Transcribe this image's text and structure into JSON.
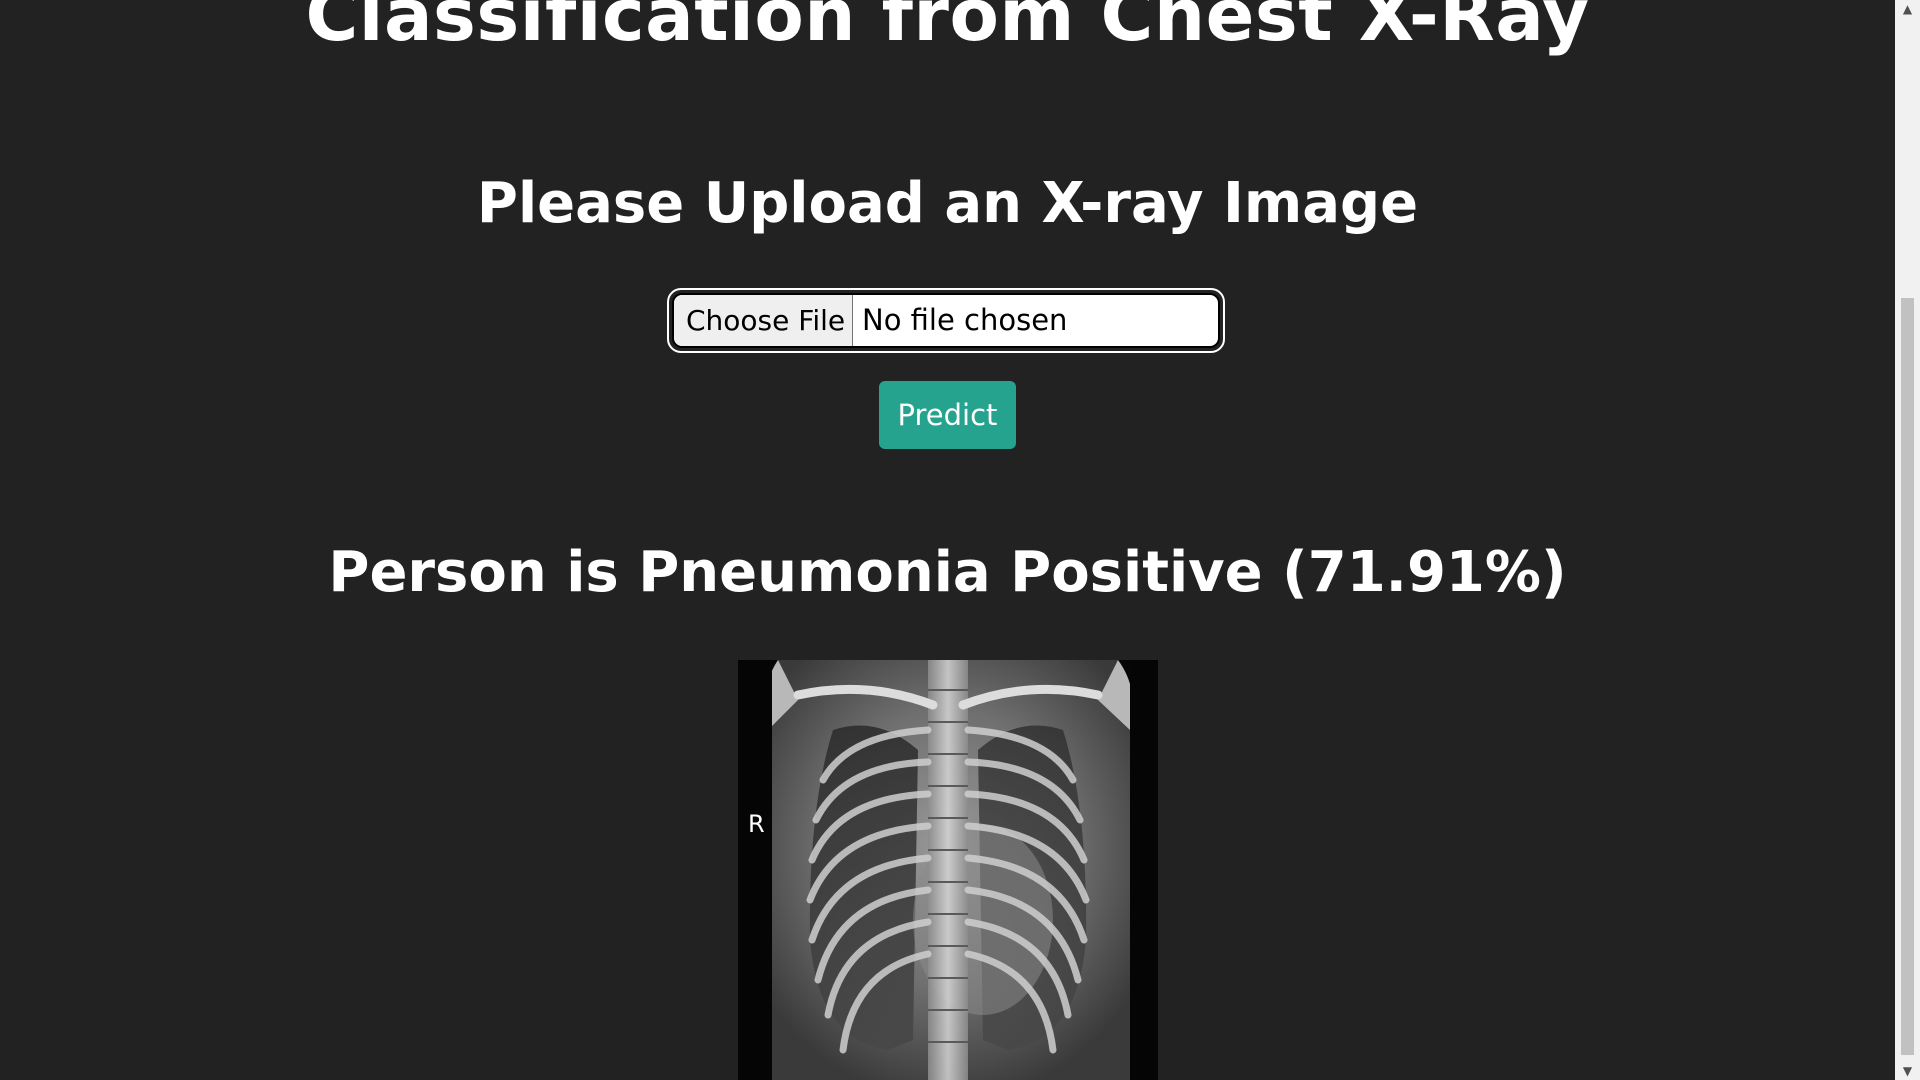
{
  "page": {
    "title": "Classification from Chest X-Ray",
    "upload_heading": "Please Upload an X-ray Image"
  },
  "file_input": {
    "button_label": "Choose File",
    "status_text": "No file chosen"
  },
  "predict_button": {
    "label": "Predict"
  },
  "result": {
    "text": "Person is Pneumonia Positive (71.91%)"
  },
  "xray_image": {
    "marker_text": "R"
  },
  "scrollbar": {
    "up_arrow": "▲",
    "down_arrow": "▼"
  },
  "colors": {
    "background": "#222222",
    "text": "#ffffff",
    "predict_button": "#26a38f",
    "scrollbar_track": "#f1f1f1",
    "scrollbar_thumb": "#c1c1c1"
  }
}
